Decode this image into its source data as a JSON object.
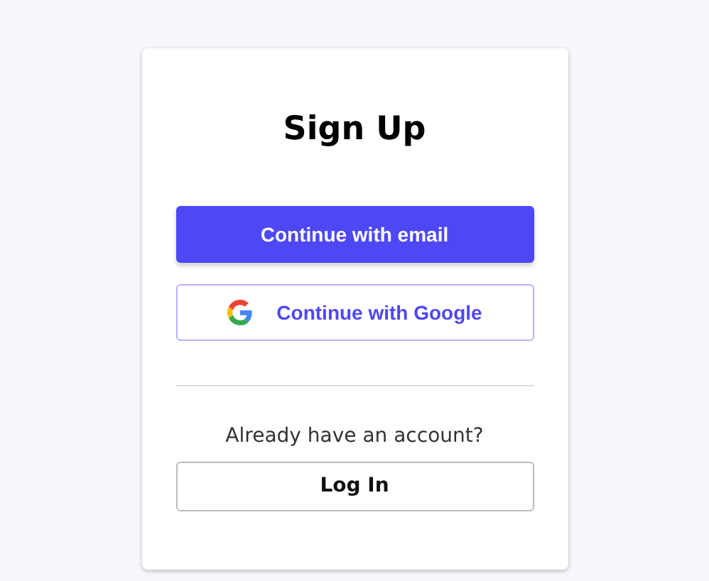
{
  "title": "Sign Up",
  "buttons": [
    {
      "kind": "primary",
      "label": "Continue with email"
    },
    {
      "kind": "google",
      "label": "Continue with Google"
    }
  ],
  "login_prompt": "Already have an account?",
  "login_button": {
    "kind": "outline",
    "label": "Log In"
  }
}
